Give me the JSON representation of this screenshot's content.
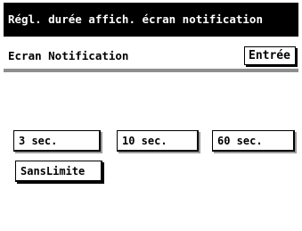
{
  "title": "Régl. durée affich. écran notification",
  "header": {
    "label": "Ecran Notification",
    "enter_label": "Entrée"
  },
  "options": {
    "sec3": "3 sec.",
    "sec10": "10 sec.",
    "sec60": "60 sec.",
    "unlimited": "SansLimite"
  }
}
